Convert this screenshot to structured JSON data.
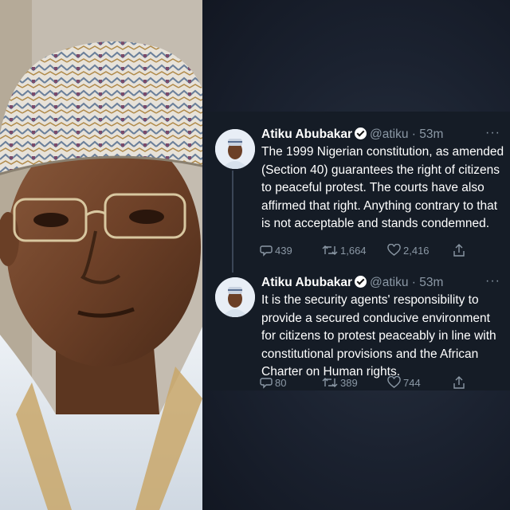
{
  "tweets": [
    {
      "name": "Atiku Abubakar",
      "handle": "@atiku",
      "separator": "·",
      "time": "53m",
      "more": "···",
      "text": "The 1999 Nigerian constitution, as amended (Section 40) guarantees the right of citizens to peaceful protest. The courts have also affirmed that right. Anything contrary to that is not acceptable and stands condemned.",
      "replies": "439",
      "retweets": "1,664",
      "likes": "2,416"
    },
    {
      "name": "Atiku Abubakar",
      "handle": "@atiku",
      "separator": "·",
      "time": "53m",
      "more": "···",
      "text": "It is the security agents' responsibility to provide a secured conducive environment for citizens to protest peaceably in line with constitutional provisions and the African Charter on Human rights.",
      "replies": "80",
      "retweets": "389",
      "likes": "744"
    }
  ],
  "icons": {
    "reply": "reply-icon",
    "retweet": "retweet-icon",
    "like": "like-icon",
    "share": "share-icon",
    "verified": "verified-badge-icon"
  },
  "colors": {
    "panel_bg": "#1b2230",
    "card_bg": "#151c26",
    "muted_text": "#8b98a5",
    "text": "#ffffff"
  }
}
